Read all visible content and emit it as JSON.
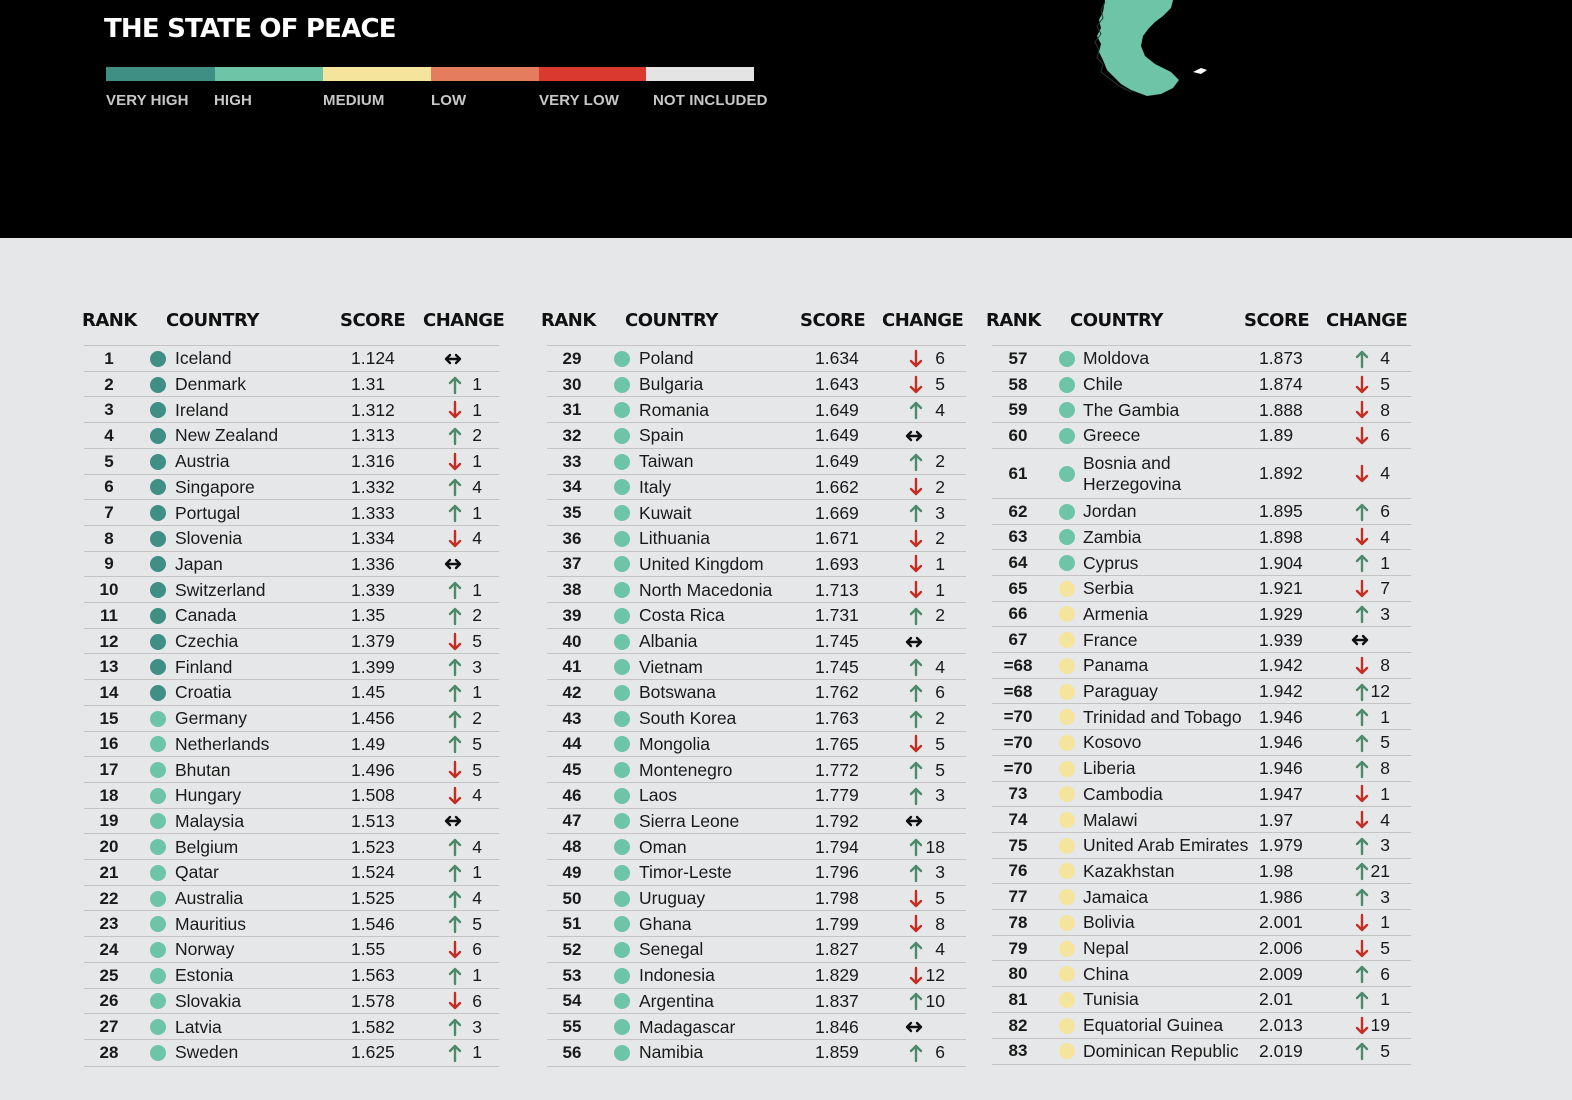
{
  "header": {
    "title": "THE STATE OF PEACE"
  },
  "legend": [
    {
      "label": "VERY HIGH",
      "color": "#3f8f85"
    },
    {
      "label": "HIGH",
      "color": "#6ec4a6"
    },
    {
      "label": "MEDIUM",
      "color": "#f5e49c"
    },
    {
      "label": "LOW",
      "color": "#e67c5e"
    },
    {
      "label": "VERY LOW",
      "color": "#d9392f"
    },
    {
      "label": "NOT INCLUDED",
      "color": "#e4e4e4"
    }
  ],
  "change_colors": {
    "up": "#4c8a6a",
    "down": "#c42e22",
    "same": "#111111"
  },
  "chart_data": {
    "type": "table",
    "columns": [
      "RANK",
      "COUNTRY",
      "SCORE",
      "CHANGE"
    ],
    "rows": [
      {
        "rank": "1",
        "country": "Iceland",
        "level": "VERY HIGH",
        "score": "1.124",
        "dir": "same",
        "change": ""
      },
      {
        "rank": "2",
        "country": "Denmark",
        "level": "VERY HIGH",
        "score": "1.31",
        "dir": "up",
        "change": "1"
      },
      {
        "rank": "3",
        "country": "Ireland",
        "level": "VERY HIGH",
        "score": "1.312",
        "dir": "down",
        "change": "1"
      },
      {
        "rank": "4",
        "country": "New Zealand",
        "level": "VERY HIGH",
        "score": "1.313",
        "dir": "up",
        "change": "2"
      },
      {
        "rank": "5",
        "country": "Austria",
        "level": "VERY HIGH",
        "score": "1.316",
        "dir": "down",
        "change": "1"
      },
      {
        "rank": "6",
        "country": "Singapore",
        "level": "VERY HIGH",
        "score": "1.332",
        "dir": "up",
        "change": "4"
      },
      {
        "rank": "7",
        "country": "Portugal",
        "level": "VERY HIGH",
        "score": "1.333",
        "dir": "up",
        "change": "1"
      },
      {
        "rank": "8",
        "country": "Slovenia",
        "level": "VERY HIGH",
        "score": "1.334",
        "dir": "down",
        "change": "4"
      },
      {
        "rank": "9",
        "country": "Japan",
        "level": "VERY HIGH",
        "score": "1.336",
        "dir": "same",
        "change": ""
      },
      {
        "rank": "10",
        "country": "Switzerland",
        "level": "VERY HIGH",
        "score": "1.339",
        "dir": "up",
        "change": "1"
      },
      {
        "rank": "11",
        "country": "Canada",
        "level": "VERY HIGH",
        "score": "1.35",
        "dir": "up",
        "change": "2"
      },
      {
        "rank": "12",
        "country": "Czechia",
        "level": "VERY HIGH",
        "score": "1.379",
        "dir": "down",
        "change": "5"
      },
      {
        "rank": "13",
        "country": "Finland",
        "level": "VERY HIGH",
        "score": "1.399",
        "dir": "up",
        "change": "3"
      },
      {
        "rank": "14",
        "country": "Croatia",
        "level": "VERY HIGH",
        "score": "1.45",
        "dir": "up",
        "change": "1"
      },
      {
        "rank": "15",
        "country": "Germany",
        "level": "HIGH",
        "score": "1.456",
        "dir": "up",
        "change": "2"
      },
      {
        "rank": "16",
        "country": "Netherlands",
        "level": "HIGH",
        "score": "1.49",
        "dir": "up",
        "change": "5"
      },
      {
        "rank": "17",
        "country": "Bhutan",
        "level": "HIGH",
        "score": "1.496",
        "dir": "down",
        "change": "5"
      },
      {
        "rank": "18",
        "country": "Hungary",
        "level": "HIGH",
        "score": "1.508",
        "dir": "down",
        "change": "4"
      },
      {
        "rank": "19",
        "country": "Malaysia",
        "level": "HIGH",
        "score": "1.513",
        "dir": "same",
        "change": ""
      },
      {
        "rank": "20",
        "country": "Belgium",
        "level": "HIGH",
        "score": "1.523",
        "dir": "up",
        "change": "4"
      },
      {
        "rank": "21",
        "country": "Qatar",
        "level": "HIGH",
        "score": "1.524",
        "dir": "up",
        "change": "1"
      },
      {
        "rank": "22",
        "country": "Australia",
        "level": "HIGH",
        "score": "1.525",
        "dir": "up",
        "change": "4"
      },
      {
        "rank": "23",
        "country": "Mauritius",
        "level": "HIGH",
        "score": "1.546",
        "dir": "up",
        "change": "5"
      },
      {
        "rank": "24",
        "country": "Norway",
        "level": "HIGH",
        "score": "1.55",
        "dir": "down",
        "change": "6"
      },
      {
        "rank": "25",
        "country": "Estonia",
        "level": "HIGH",
        "score": "1.563",
        "dir": "up",
        "change": "1"
      },
      {
        "rank": "26",
        "country": "Slovakia",
        "level": "HIGH",
        "score": "1.578",
        "dir": "down",
        "change": "6"
      },
      {
        "rank": "27",
        "country": "Latvia",
        "level": "HIGH",
        "score": "1.582",
        "dir": "up",
        "change": "3"
      },
      {
        "rank": "28",
        "country": "Sweden",
        "level": "HIGH",
        "score": "1.625",
        "dir": "up",
        "change": "1"
      },
      {
        "rank": "29",
        "country": "Poland",
        "level": "HIGH",
        "score": "1.634",
        "dir": "down",
        "change": "6"
      },
      {
        "rank": "30",
        "country": "Bulgaria",
        "level": "HIGH",
        "score": "1.643",
        "dir": "down",
        "change": "5"
      },
      {
        "rank": "31",
        "country": "Romania",
        "level": "HIGH",
        "score": "1.649",
        "dir": "up",
        "change": "4"
      },
      {
        "rank": "32",
        "country": "Spain",
        "level": "HIGH",
        "score": "1.649",
        "dir": "same",
        "change": ""
      },
      {
        "rank": "33",
        "country": "Taiwan",
        "level": "HIGH",
        "score": "1.649",
        "dir": "up",
        "change": "2"
      },
      {
        "rank": "34",
        "country": "Italy",
        "level": "HIGH",
        "score": "1.662",
        "dir": "down",
        "change": "2"
      },
      {
        "rank": "35",
        "country": "Kuwait",
        "level": "HIGH",
        "score": "1.669",
        "dir": "up",
        "change": "3"
      },
      {
        "rank": "36",
        "country": "Lithuania",
        "level": "HIGH",
        "score": "1.671",
        "dir": "down",
        "change": "2"
      },
      {
        "rank": "37",
        "country": "United Kingdom",
        "level": "HIGH",
        "score": "1.693",
        "dir": "down",
        "change": "1"
      },
      {
        "rank": "38",
        "country": "North Macedonia",
        "level": "HIGH",
        "score": "1.713",
        "dir": "down",
        "change": "1"
      },
      {
        "rank": "39",
        "country": "Costa Rica",
        "level": "HIGH",
        "score": "1.731",
        "dir": "up",
        "change": "2"
      },
      {
        "rank": "40",
        "country": "Albania",
        "level": "HIGH",
        "score": "1.745",
        "dir": "same",
        "change": ""
      },
      {
        "rank": "41",
        "country": "Vietnam",
        "level": "HIGH",
        "score": "1.745",
        "dir": "up",
        "change": "4"
      },
      {
        "rank": "42",
        "country": "Botswana",
        "level": "HIGH",
        "score": "1.762",
        "dir": "up",
        "change": "6"
      },
      {
        "rank": "43",
        "country": "South Korea",
        "level": "HIGH",
        "score": "1.763",
        "dir": "up",
        "change": "2"
      },
      {
        "rank": "44",
        "country": "Mongolia",
        "level": "HIGH",
        "score": "1.765",
        "dir": "down",
        "change": "5"
      },
      {
        "rank": "45",
        "country": "Montenegro",
        "level": "HIGH",
        "score": "1.772",
        "dir": "up",
        "change": "5"
      },
      {
        "rank": "46",
        "country": "Laos",
        "level": "HIGH",
        "score": "1.779",
        "dir": "up",
        "change": "3"
      },
      {
        "rank": "47",
        "country": "Sierra Leone",
        "level": "HIGH",
        "score": "1.792",
        "dir": "same",
        "change": ""
      },
      {
        "rank": "48",
        "country": "Oman",
        "level": "HIGH",
        "score": "1.794",
        "dir": "up",
        "change": "18"
      },
      {
        "rank": "49",
        "country": "Timor-Leste",
        "level": "HIGH",
        "score": "1.796",
        "dir": "up",
        "change": "3"
      },
      {
        "rank": "50",
        "country": "Uruguay",
        "level": "HIGH",
        "score": "1.798",
        "dir": "down",
        "change": "5"
      },
      {
        "rank": "51",
        "country": "Ghana",
        "level": "HIGH",
        "score": "1.799",
        "dir": "down",
        "change": "8"
      },
      {
        "rank": "52",
        "country": "Senegal",
        "level": "HIGH",
        "score": "1.827",
        "dir": "up",
        "change": "4"
      },
      {
        "rank": "53",
        "country": "Indonesia",
        "level": "HIGH",
        "score": "1.829",
        "dir": "down",
        "change": "12"
      },
      {
        "rank": "54",
        "country": "Argentina",
        "level": "HIGH",
        "score": "1.837",
        "dir": "up",
        "change": "10"
      },
      {
        "rank": "55",
        "country": "Madagascar",
        "level": "HIGH",
        "score": "1.846",
        "dir": "same",
        "change": ""
      },
      {
        "rank": "56",
        "country": "Namibia",
        "level": "HIGH",
        "score": "1.859",
        "dir": "up",
        "change": "6"
      },
      {
        "rank": "57",
        "country": "Moldova",
        "level": "HIGH",
        "score": "1.873",
        "dir": "up",
        "change": "4"
      },
      {
        "rank": "58",
        "country": "Chile",
        "level": "HIGH",
        "score": "1.874",
        "dir": "down",
        "change": "5"
      },
      {
        "rank": "59",
        "country": "The Gambia",
        "level": "HIGH",
        "score": "1.888",
        "dir": "down",
        "change": "8"
      },
      {
        "rank": "60",
        "country": "Greece",
        "level": "HIGH",
        "score": "1.89",
        "dir": "down",
        "change": "6"
      },
      {
        "rank": "61",
        "country": "Bosnia and Herzegovina",
        "level": "HIGH",
        "score": "1.892",
        "dir": "down",
        "change": "4"
      },
      {
        "rank": "62",
        "country": "Jordan",
        "level": "HIGH",
        "score": "1.895",
        "dir": "up",
        "change": "6"
      },
      {
        "rank": "63",
        "country": "Zambia",
        "level": "HIGH",
        "score": "1.898",
        "dir": "down",
        "change": "4"
      },
      {
        "rank": "64",
        "country": "Cyprus",
        "level": "HIGH",
        "score": "1.904",
        "dir": "up",
        "change": "1"
      },
      {
        "rank": "65",
        "country": "Serbia",
        "level": "MEDIUM",
        "score": "1.921",
        "dir": "down",
        "change": "7"
      },
      {
        "rank": "66",
        "country": "Armenia",
        "level": "MEDIUM",
        "score": "1.929",
        "dir": "up",
        "change": "3"
      },
      {
        "rank": "67",
        "country": "France",
        "level": "MEDIUM",
        "score": "1.939",
        "dir": "same",
        "change": ""
      },
      {
        "rank": "=68",
        "country": "Panama",
        "level": "MEDIUM",
        "score": "1.942",
        "dir": "down",
        "change": "8"
      },
      {
        "rank": "=68",
        "country": "Paraguay",
        "level": "MEDIUM",
        "score": "1.942",
        "dir": "up",
        "change": "12"
      },
      {
        "rank": "=70",
        "country": "Trinidad and Tobago",
        "level": "MEDIUM",
        "score": "1.946",
        "dir": "up",
        "change": "1"
      },
      {
        "rank": "=70",
        "country": "Kosovo",
        "level": "MEDIUM",
        "score": "1.946",
        "dir": "up",
        "change": "5"
      },
      {
        "rank": "=70",
        "country": "Liberia",
        "level": "MEDIUM",
        "score": "1.946",
        "dir": "up",
        "change": "8"
      },
      {
        "rank": "73",
        "country": "Cambodia",
        "level": "MEDIUM",
        "score": "1.947",
        "dir": "down",
        "change": "1"
      },
      {
        "rank": "74",
        "country": "Malawi",
        "level": "MEDIUM",
        "score": "1.97",
        "dir": "down",
        "change": "4"
      },
      {
        "rank": "75",
        "country": "United Arab Emirates",
        "level": "MEDIUM",
        "score": "1.979",
        "dir": "up",
        "change": "3"
      },
      {
        "rank": "76",
        "country": "Kazakhstan",
        "level": "MEDIUM",
        "score": "1.98",
        "dir": "up",
        "change": "21"
      },
      {
        "rank": "77",
        "country": "Jamaica",
        "level": "MEDIUM",
        "score": "1.986",
        "dir": "up",
        "change": "3"
      },
      {
        "rank": "78",
        "country": "Bolivia",
        "level": "MEDIUM",
        "score": "2.001",
        "dir": "down",
        "change": "1"
      },
      {
        "rank": "79",
        "country": "Nepal",
        "level": "MEDIUM",
        "score": "2.006",
        "dir": "down",
        "change": "5"
      },
      {
        "rank": "80",
        "country": "China",
        "level": "MEDIUM",
        "score": "2.009",
        "dir": "up",
        "change": "6"
      },
      {
        "rank": "81",
        "country": "Tunisia",
        "level": "MEDIUM",
        "score": "2.01",
        "dir": "up",
        "change": "1"
      },
      {
        "rank": "82",
        "country": "Equatorial Guinea",
        "level": "MEDIUM",
        "score": "2.013",
        "dir": "down",
        "change": "19"
      },
      {
        "rank": "83",
        "country": "Dominican Republic",
        "level": "MEDIUM",
        "score": "2.019",
        "dir": "up",
        "change": "5"
      }
    ]
  }
}
